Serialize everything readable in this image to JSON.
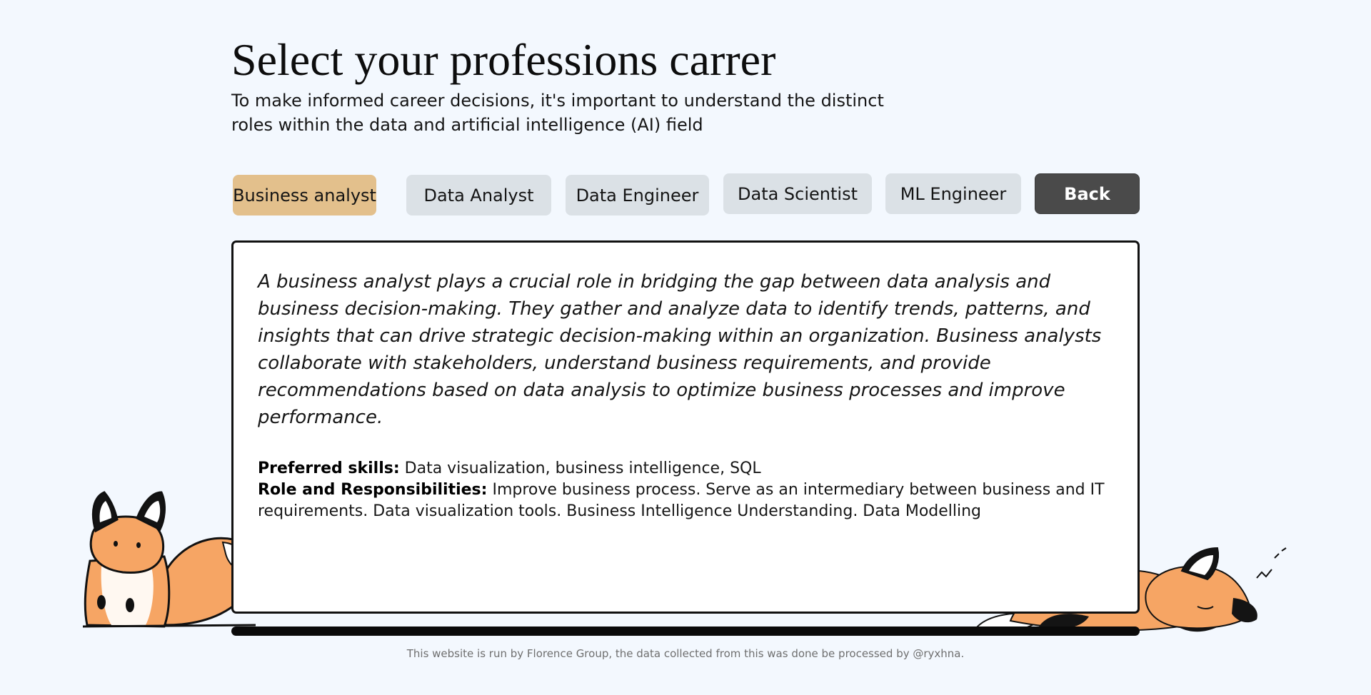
{
  "page": {
    "title": "Select your professions carrer",
    "subtitle": "To make informed career decisions, it's important to understand the distinct roles within the data and artificial intelligence (AI) field"
  },
  "tabs": [
    {
      "label": "Business analyst",
      "active": true
    },
    {
      "label": "Data Analyst",
      "active": false
    },
    {
      "label": "Data Engineer",
      "active": false
    },
    {
      "label": "Data Scientist",
      "active": false
    },
    {
      "label": "ML Engineer",
      "active": false
    }
  ],
  "back_label": "Back",
  "content": {
    "description": "A business analyst plays a crucial role in bridging the gap between data analysis and business decision-making. They gather and analyze data to identify trends, patterns, and insights that can drive strategic decision-making within an organization. Business analysts collaborate with stakeholders, understand business requirements, and provide recommendations based on data analysis to optimize business processes and improve performance.",
    "skills_label": "Preferred skills:",
    "skills_text": "Data visualization, business intelligence, SQL",
    "roles_label": "Role and Responsibilities:",
    "roles_text": "Improve business process. Serve as an intermediary between business and IT requirements. Data visualization tools. Business Intelligence Understanding. Data Modelling"
  },
  "footer": "This website is run by Florence Group, the data collected from this was done be processed by @ryxhna.",
  "colors": {
    "background": "#f3f8fe",
    "active_tab": "#e3c08c",
    "tab": "#dbe1e6",
    "back_button": "#4a4a4a",
    "fox_orange": "#f5a05a"
  }
}
